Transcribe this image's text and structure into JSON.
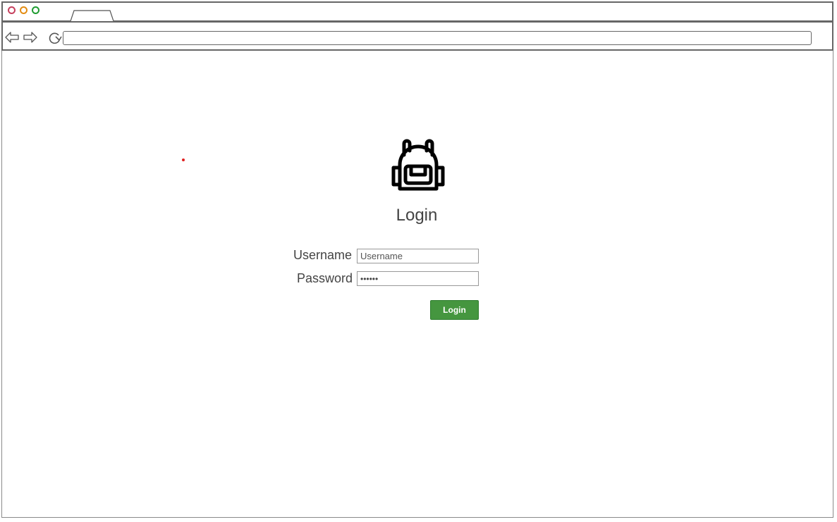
{
  "browser": {
    "window_controls": [
      "close-icon",
      "minimize-icon",
      "maximize-icon"
    ],
    "colors": {
      "close": "#c6405d",
      "minimize": "#e38c12",
      "maximize": "#1f9c31"
    },
    "url": ""
  },
  "login": {
    "title": "Login",
    "logo_icon": "backpack-icon",
    "username_label": "Username",
    "username_placeholder": "Username",
    "password_label": "Password",
    "password_value": "••••••",
    "submit_label": "Login",
    "submit_color": "#45963f"
  }
}
